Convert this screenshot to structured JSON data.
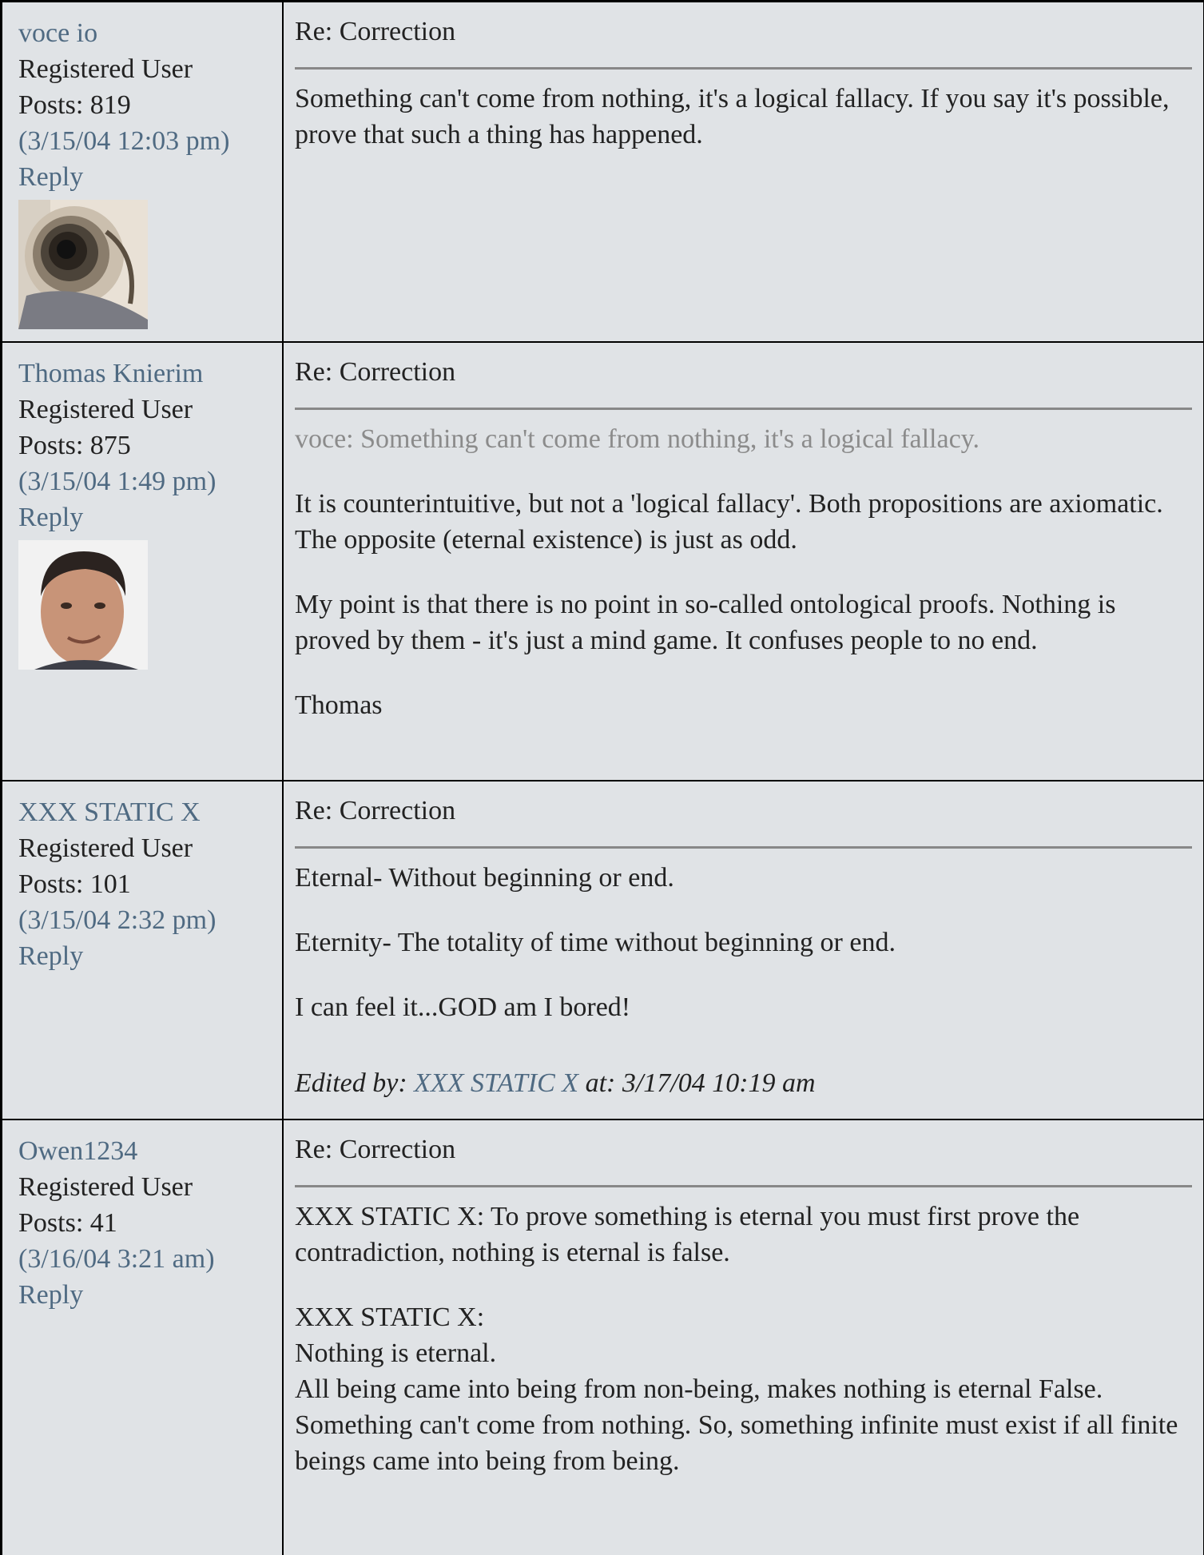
{
  "posts": [
    {
      "username": "voce io",
      "role": "Registered User",
      "posts_label": "Posts: 819",
      "timestamp": "(3/15/04 12:03 pm)",
      "reply_label": "Reply",
      "subject": "Re: Correction",
      "paragraphs": [
        "Something can't come from nothing, it's a logical fallacy. If you say it's possible, prove that such a thing has happened."
      ]
    },
    {
      "username": "Thomas Knierim",
      "role": "Registered User",
      "posts_label": "Posts: 875",
      "timestamp": "(3/15/04 1:49 pm)",
      "reply_label": "Reply",
      "subject": "Re: Correction",
      "quote": "voce: Something can't come from nothing, it's a logical fallacy.",
      "paragraphs": [
        "It is counterintuitive, but not a 'logical fallacy'. Both propositions are axiomatic. The opposite (eternal existence) is just as odd.",
        "My point is that there is no point in so-called ontological proofs. Nothing is proved by them - it's just a mind game. It confuses people to no end.",
        "Thomas"
      ]
    },
    {
      "username": "XXX STATIC X",
      "role": "Registered User",
      "posts_label": "Posts: 101",
      "timestamp": "(3/15/04 2:32 pm)",
      "reply_label": "Reply",
      "subject": "Re: Correction",
      "paragraphs": [
        "Eternal- Without beginning or end.",
        "Eternity- The totality of time without beginning or end.",
        "I can feel it...GOD am I bored!"
      ],
      "edited_prefix": "Edited by:",
      "edited_user": "XXX STATIC X",
      "edited_suffix": "at: 3/17/04 10:19 am"
    },
    {
      "username": "Owen1234",
      "role": "Registered User",
      "posts_label": "Posts: 41",
      "timestamp": "(3/16/04 3:21 am)",
      "reply_label": "Reply",
      "subject": "Re: Correction",
      "paragraphs": [
        "XXX STATIC X: To prove something is eternal you must first prove the contradiction, nothing is eternal is false."
      ],
      "lines": [
        "XXX STATIC X:",
        "Nothing is eternal.",
        "All being came into being from non-being, makes nothing is eternal False.",
        "Something can't come from nothing. So, something infinite must exist if all finite beings came into being from being."
      ]
    }
  ]
}
